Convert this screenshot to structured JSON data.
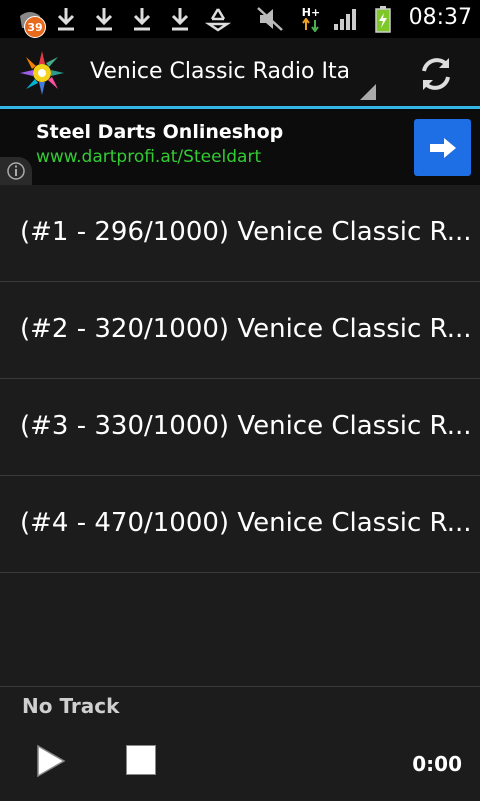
{
  "status_bar": {
    "notification_count": "39",
    "network_type": "H+",
    "time": "08:37",
    "icons": [
      "notification-icon",
      "download-icon",
      "download-icon",
      "download-icon",
      "download-icon",
      "recycle-icon",
      "mute-icon",
      "network-icon",
      "signal-icon",
      "battery-icon"
    ]
  },
  "action_bar": {
    "title": "Venice Classic Radio Italia",
    "refresh_icon": "refresh-icon",
    "accent_color": "#33b5e5"
  },
  "ad": {
    "title": "Steel Darts Onlineshop",
    "url": "www.dartprofi.at/Steeldart",
    "url_color": "#33cc33",
    "button_color": "#1e6fe6"
  },
  "stations": [
    {
      "label": "(#1 - 296/1000) Venice Classic R..."
    },
    {
      "label": "(#2 - 320/1000) Venice Classic R..."
    },
    {
      "label": "(#3 - 330/1000) Venice Classic R..."
    },
    {
      "label": "(#4 - 470/1000) Venice Classic R..."
    }
  ],
  "player": {
    "track": "No Track",
    "time": "0:00"
  }
}
